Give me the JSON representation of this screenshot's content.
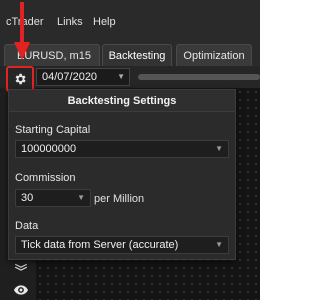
{
  "menubar": {
    "items": [
      "cTrader",
      "Links",
      "Help"
    ]
  },
  "tabs": [
    {
      "label": "EURUSD, m15",
      "active": false
    },
    {
      "label": "Backtesting",
      "active": true
    },
    {
      "label": "Optimization",
      "active": false
    }
  ],
  "toolbar": {
    "settings_icon": "gear-icon",
    "date_value": "04/07/2020"
  },
  "popup": {
    "title": "Backtesting Settings",
    "starting_capital": {
      "label": "Starting Capital",
      "value": "100000000"
    },
    "commission": {
      "label": "Commission",
      "value": "30",
      "suffix": "per Million"
    },
    "data": {
      "label": "Data",
      "value": "Tick data from Server (accurate)"
    }
  },
  "sidebar": {
    "icons": [
      "layers-icon",
      "eye-icon"
    ]
  },
  "colors": {
    "highlight": "#e02424",
    "background": "#1f1f1f",
    "panel": "#2b2b2b"
  }
}
